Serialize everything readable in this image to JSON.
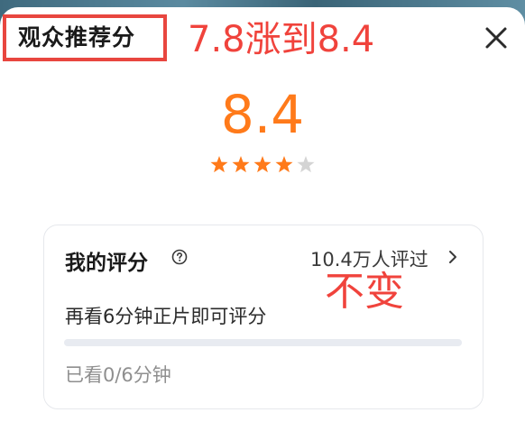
{
  "panel": {
    "title": "观众推荐分",
    "score": "8.4",
    "stars": {
      "filled": 4,
      "total": 5,
      "filled_color": "#ff7a1a",
      "empty_color": "#d4d4d4"
    },
    "close_icon": "close-icon"
  },
  "annotations": {
    "change": "7.8涨到8.4",
    "unchanged": "不变",
    "color": "#f0433c"
  },
  "my_rating": {
    "label": "我的评分",
    "help_icon": "help-circle-icon",
    "raters_text": "10.4万人评过",
    "hint": "再看6分钟正片即可评分",
    "progress_fraction": 0,
    "watched_text": "已看0/6分钟"
  },
  "colors": {
    "accent": "#ff7a1a",
    "highlight_box": "#e8463f"
  }
}
